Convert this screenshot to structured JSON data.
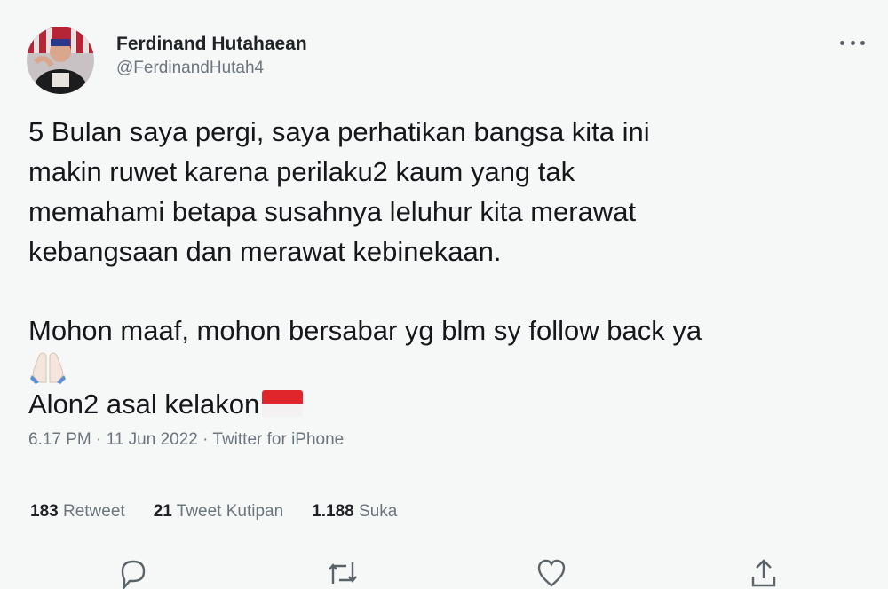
{
  "author": {
    "name": "Ferdinand Hutahaean",
    "handle": "@FerdinandHutah4"
  },
  "tweet": {
    "lines": [
      "5 Bulan saya pergi, saya perhatikan bangsa kita ini",
      "makin ruwet karena perilaku2 kaum yang tak",
      "memahami betapa susahnya leluhur kita merawat",
      "kebangsaan dan merawat kebinekaan."
    ],
    "line2": "Mohon maaf, mohon bersabar yg blm sy follow back ya",
    "line3": "Alon2 asal kelakon",
    "emoji": [
      "folded-hands-emoji",
      "indonesia-flag-emoji"
    ]
  },
  "meta": {
    "time": "6.17 PM",
    "date": "11 Jun 2022",
    "source": "Twitter for iPhone",
    "separator": "·"
  },
  "stats": {
    "retweets_count": "183",
    "retweets_label": "Retweet",
    "quotes_count": "21",
    "quotes_label": "Tweet Kutipan",
    "likes_count": "1.188",
    "likes_label": "Suka"
  },
  "icons": {
    "reply": "reply-icon",
    "retweet": "retweet-icon",
    "like": "like-icon",
    "share": "share-icon",
    "more": "more-icon"
  },
  "colors": {
    "background": "#f6f7f7",
    "text": "#15181b",
    "secondary": "#6d767e",
    "flag_red": "#e0252b"
  }
}
